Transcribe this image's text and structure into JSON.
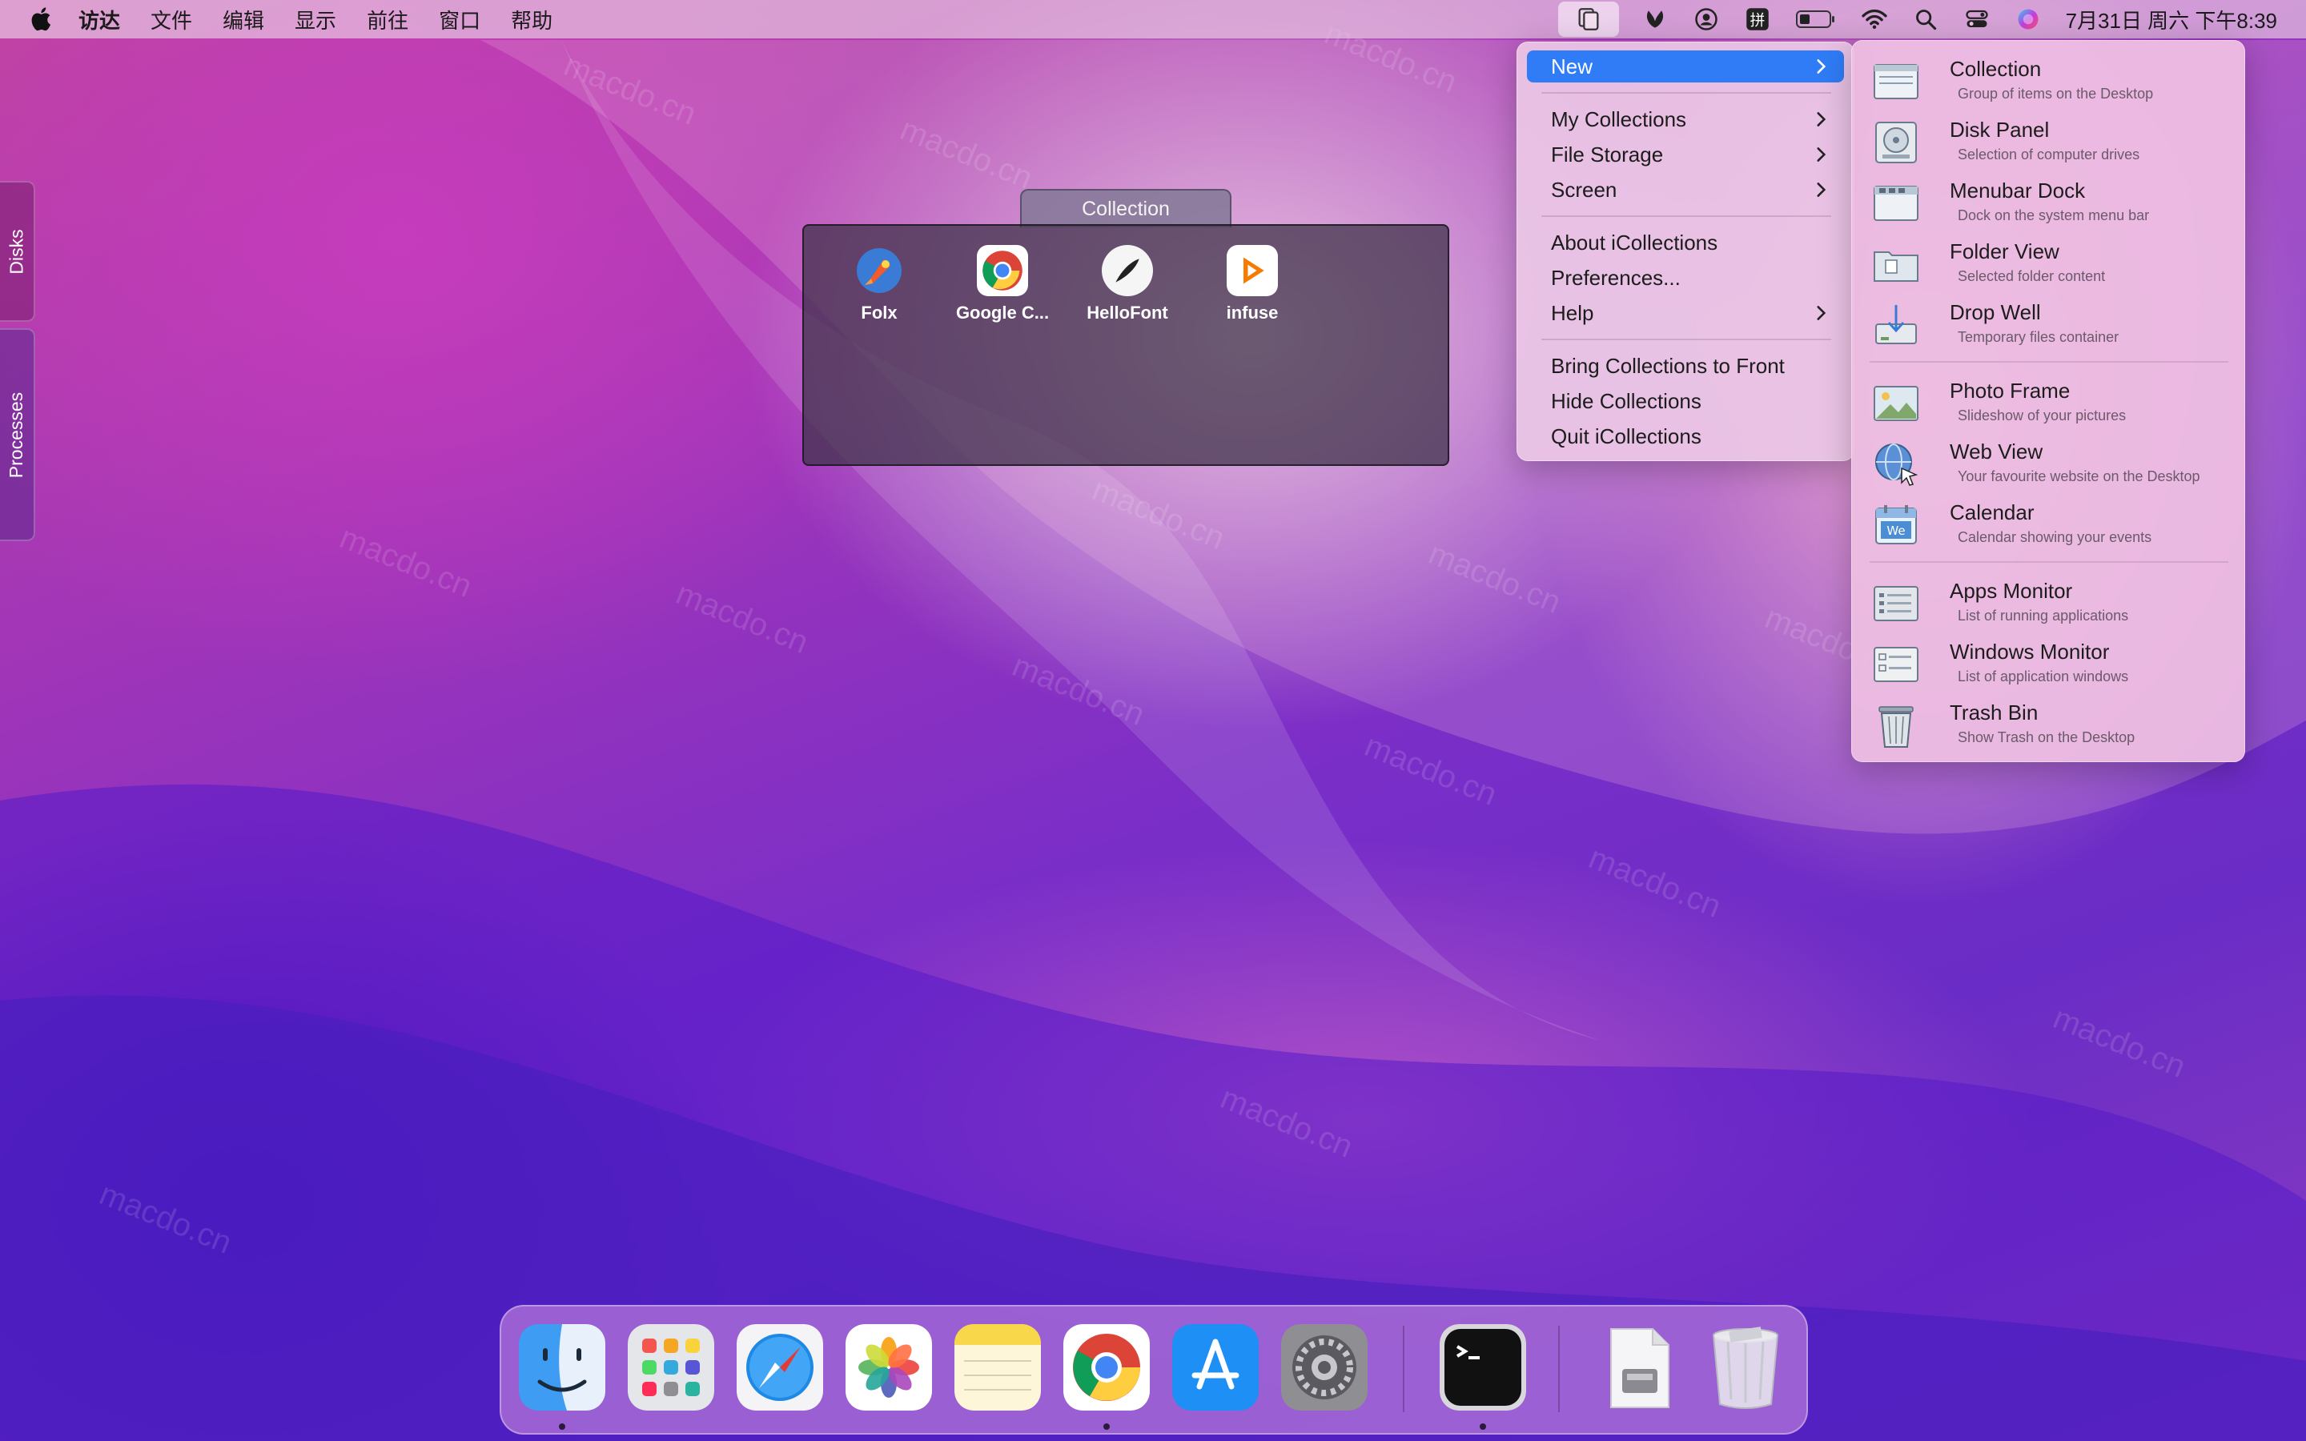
{
  "menubar": {
    "app_name": "访达",
    "menus": [
      "文件",
      "编辑",
      "显示",
      "前往",
      "窗口",
      "帮助"
    ],
    "clock": "7月31日 周六 下午8:39"
  },
  "side_tabs": {
    "disks": "Disks",
    "processes": "Processes"
  },
  "collection": {
    "title": "Collection",
    "items": [
      {
        "label": "Folx",
        "icon": "folx-icon"
      },
      {
        "label": "Google C...",
        "icon": "chrome-icon"
      },
      {
        "label": "HelloFont",
        "icon": "hellofont-icon"
      },
      {
        "label": "infuse",
        "icon": "infuse-icon"
      }
    ]
  },
  "dropdown": {
    "new": "New",
    "my_collections": "My Collections",
    "file_storage": "File Storage",
    "screen": "Screen",
    "about": "About iCollections",
    "preferences": "Preferences...",
    "help": "Help",
    "bring_front": "Bring Collections to Front",
    "hide": "Hide Collections",
    "quit": "Quit iCollections"
  },
  "submenu": {
    "items": [
      {
        "name": "Collection",
        "desc": "Group of items on the Desktop"
      },
      {
        "name": "Disk Panel",
        "desc": "Selection of computer drives"
      },
      {
        "name": "Menubar Dock",
        "desc": "Dock on the system menu bar"
      },
      {
        "name": "Folder View",
        "desc": "Selected folder content"
      },
      {
        "name": "Drop Well",
        "desc": "Temporary files container"
      },
      {
        "name": "Photo Frame",
        "desc": "Slideshow of your pictures"
      },
      {
        "name": "Web View",
        "desc": "Your favourite website on the Desktop"
      },
      {
        "name": "Calendar",
        "desc": "Calendar showing your events"
      },
      {
        "name": "Apps Monitor",
        "desc": "List of running applications"
      },
      {
        "name": "Windows Monitor",
        "desc": "List of application windows"
      },
      {
        "name": "Trash Bin",
        "desc": "Show Trash on the Desktop"
      }
    ]
  },
  "dock": {
    "apps": [
      "finder-icon",
      "launchpad-icon",
      "safari-icon",
      "photos-icon",
      "notes-icon",
      "chrome-icon",
      "app-store-icon",
      "system-preferences-icon",
      "terminal-icon",
      "downloads-stack-icon",
      "trash-icon"
    ]
  },
  "watermark_text": "macdo.cn",
  "colors": {
    "highlight": "#2f7cf6"
  }
}
